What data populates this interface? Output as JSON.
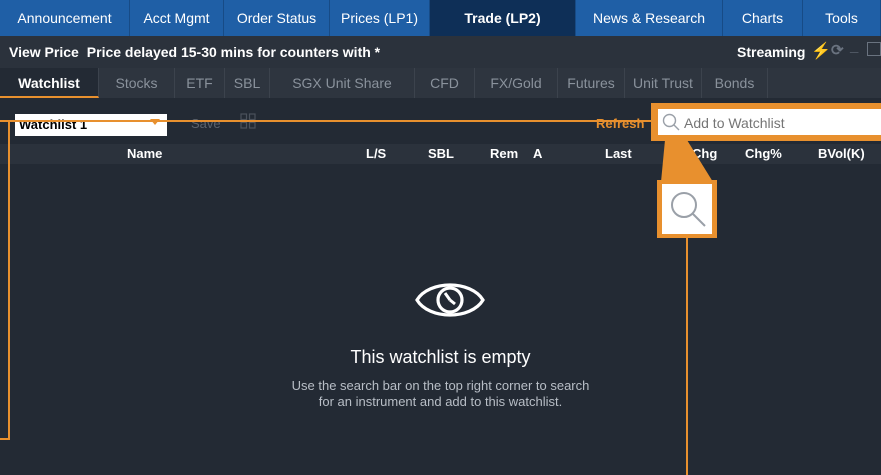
{
  "topnav": {
    "items": [
      {
        "label": "Announcement"
      },
      {
        "label": "Acct Mgmt"
      },
      {
        "label": "Order Status"
      },
      {
        "label": "Prices (LP1)"
      },
      {
        "label": "Trade (LP2)"
      },
      {
        "label": "News & Research"
      },
      {
        "label": "Charts"
      },
      {
        "label": "Tools"
      }
    ],
    "active": "Trade (LP2)"
  },
  "viewbar": {
    "title": "View Price",
    "delay_text": "Price delayed 15-30 mins for counters with *",
    "streaming_label": "Streaming",
    "icons": [
      "lightning-icon",
      "refresh-icon",
      "minimize-icon",
      "maximize-icon"
    ]
  },
  "subtabs": {
    "items": [
      {
        "label": "Watchlist"
      },
      {
        "label": "Stocks"
      },
      {
        "label": "ETF"
      },
      {
        "label": "SBL"
      },
      {
        "label": "SGX Unit Share"
      },
      {
        "label": "CFD"
      },
      {
        "label": "FX/Gold"
      },
      {
        "label": "Futures"
      },
      {
        "label": "Unit Trust"
      },
      {
        "label": "Bonds"
      }
    ],
    "active": "Watchlist"
  },
  "toolbar": {
    "watchlist_value": "Watchlist 1",
    "save_label": "Save",
    "refresh_label": "Refresh",
    "search_placeholder": "Add to Watchlist"
  },
  "table": {
    "columns": [
      "Name",
      "L/S",
      "SBL",
      "Rem",
      "A",
      "Last",
      "Chg",
      "Chg%",
      "BVol(K)"
    ]
  },
  "empty_state": {
    "title": "This watchlist is empty",
    "line1": "Use the search bar on the top right corner to search",
    "line2": "for an instrument and add to this watchlist."
  },
  "colors": {
    "accent": "#e8902e",
    "nav_bg": "#1f5fa6",
    "nav_active": "#0e2f57",
    "panel_bg": "#232a34"
  }
}
